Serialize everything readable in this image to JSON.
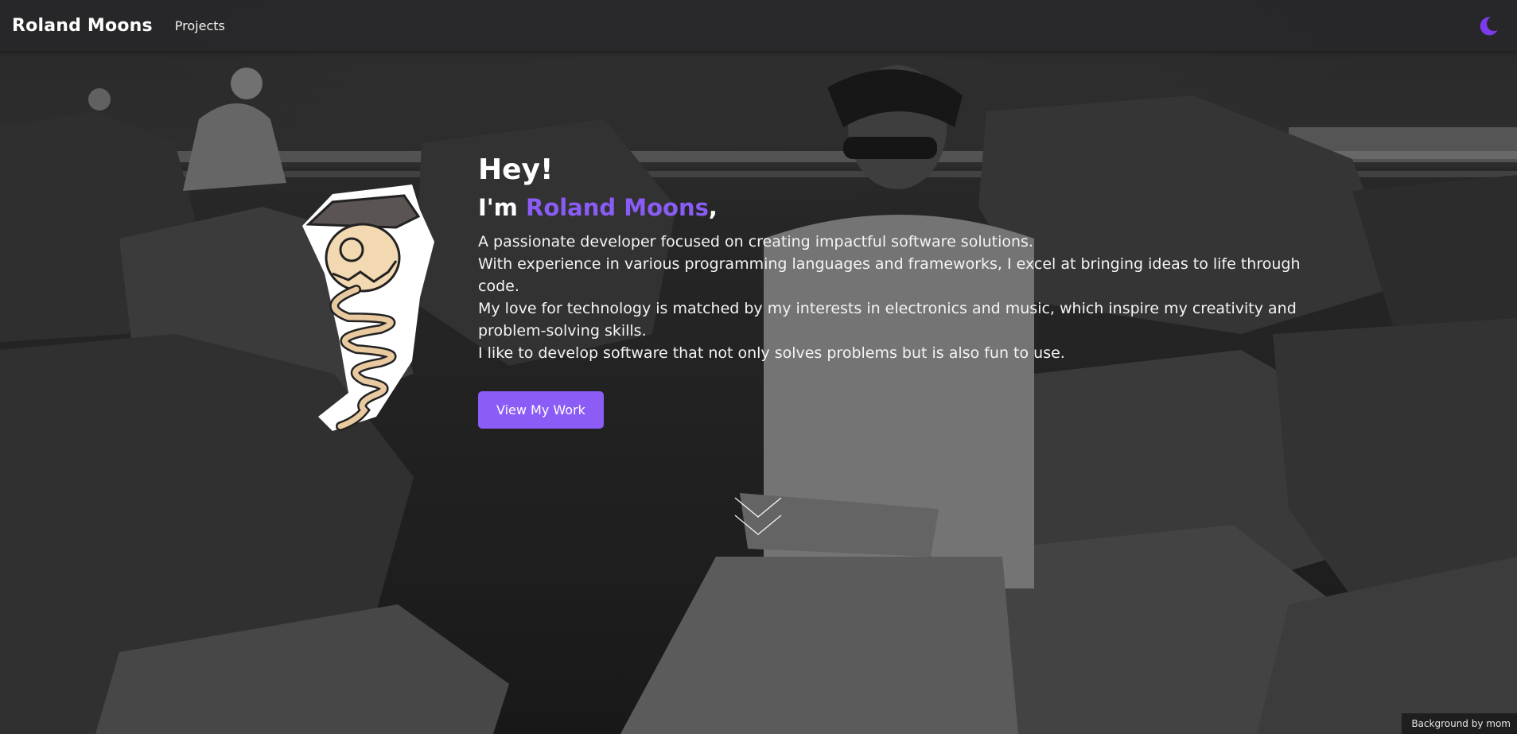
{
  "nav": {
    "brand": "Roland Moons",
    "links": [
      {
        "label": "Projects"
      }
    ],
    "theme_icon": "moon-icon",
    "accent_color": "#8b5cf6"
  },
  "hero": {
    "greeting": "Hey!",
    "intro_prefix": "I'm ",
    "intro_name": "Roland Moons",
    "intro_suffix": ",",
    "bio_lines": [
      "A passionate developer focused on creating impactful software solutions.",
      "With experience in various programming languages and frameworks, I excel at bringing ideas to life through code.",
      "My love for technology is matched by my interests in electronics and music, which inspire my creativity and problem-solving skills.",
      "I like to develop software that not only solves problems but is also fun to use."
    ],
    "cta_label": "View My Work",
    "scroll_icon": "chevron-down-icon",
    "mascot_icon": "mascot-sticker-icon"
  },
  "footer": {
    "credit": "Background by mom"
  }
}
